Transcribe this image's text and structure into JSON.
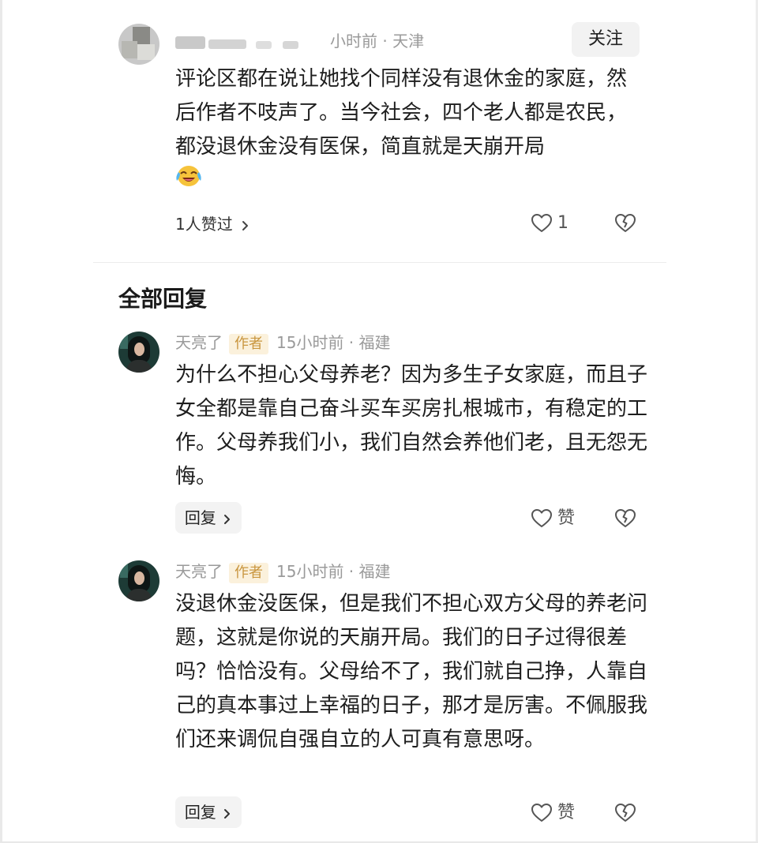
{
  "top_comment": {
    "meta_suffix": "小时前 · 天津",
    "follow_label": "关注",
    "text": "评论区都在说让她找个同样没有退休金的家庭，然后作者不吱声了。当今社会，四个老人都是农民，都没退休金没有医保，简直就是天崩开局",
    "emoji": "laughing-crying-emoji",
    "likes_link": "1人赞过",
    "like_count": "1"
  },
  "replies_section": {
    "title": "全部回复"
  },
  "replies": [
    {
      "username": "天亮了",
      "author_tag": "作者",
      "meta": "15小时前 · 福建",
      "text": "为什么不担心父母养老？因为多生子女家庭，而且子女全都是靠自己奋斗买车买房扎根城市，有稳定的工作。父母养我们小，我们自然会养他们老，且无怨无悔。",
      "reply_label": "回复",
      "like_label": "赞"
    },
    {
      "username": "天亮了",
      "author_tag": "作者",
      "meta": "15小时前 · 福建",
      "text": "没退休金没医保，但是我们不担心双方父母的养老问题，这就是你说的天崩开局。我们的日子过得很差吗？恰恰没有。父母给不了，我们就自己挣，人靠自己的真本事过上幸福的日子，那才是厉害。不佩服我们还来调侃自强自立的人可真有意思呀。",
      "reply_label": "回复",
      "like_label": "赞"
    }
  ],
  "icons": {
    "like": "heart-outline-icon",
    "dislike": "broken-heart-icon",
    "chevron": "chevron-right-icon"
  },
  "colors": {
    "author_tag_bg": "#fbf1dc",
    "author_tag_text": "#c9963f",
    "meta_text": "#9a9a9a",
    "button_bg": "#f2f2f2"
  }
}
